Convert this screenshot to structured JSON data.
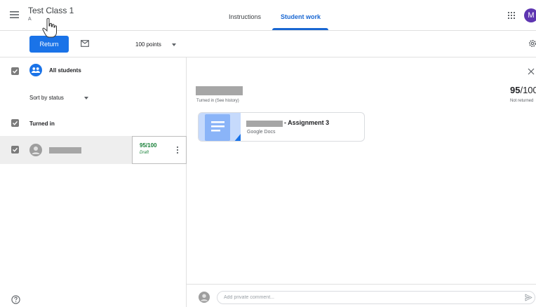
{
  "header": {
    "class_title": "Test Class 1",
    "class_section": "A",
    "tabs": [
      {
        "label": "Instructions",
        "active": false
      },
      {
        "label": "Student work",
        "active": true
      }
    ],
    "avatar_initial": "M",
    "icons": [
      "menu-icon",
      "apps-grid-icon"
    ]
  },
  "toolbar": {
    "return_label": "Return",
    "points_label": "100 points",
    "icons": [
      "mail-icon",
      "settings-icon"
    ]
  },
  "student_list": {
    "all_students_label": "All students",
    "sort_label": "Sort by status",
    "section_label": "Turned in",
    "students": [
      {
        "grade": "95/100",
        "status": "Draft"
      }
    ]
  },
  "detail": {
    "history_link": "Turned in (See history)",
    "score": "95",
    "score_total": "/100",
    "score_status": "Not returned",
    "attachment": {
      "title": "- Assignment 3",
      "type": "Google Docs"
    }
  },
  "comment": {
    "placeholder": "Add private comment..."
  },
  "colors": {
    "primary": "#1a73e8",
    "tab_active": "#1967d2",
    "grade_green": "#188038",
    "avatar_purple": "#5e35b1"
  }
}
